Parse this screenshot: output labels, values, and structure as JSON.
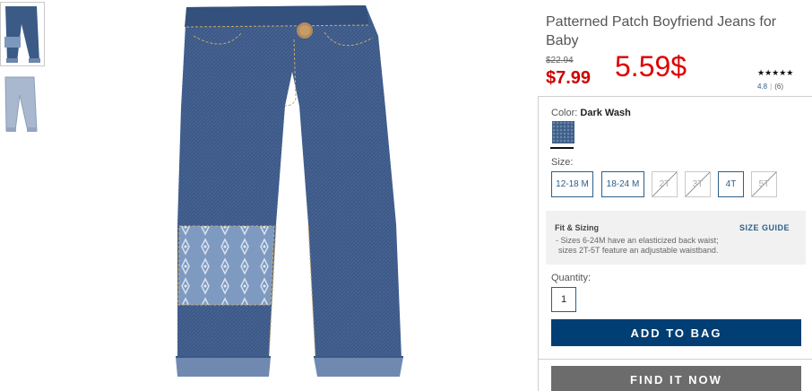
{
  "product": {
    "title": "Patterned Patch Boyfriend Jeans for Baby",
    "was_price": "$22.94",
    "price": "$7.99",
    "overlay_price": "5.59$",
    "stars": "★★★★★",
    "rating_value": "4.8",
    "rating_separator": "|",
    "rating_count": "(6)"
  },
  "thumbnails": [
    {
      "label": "",
      "selected": true
    },
    {
      "label": "",
      "selected": false
    }
  ],
  "options": {
    "color_label": "Color:",
    "color_value": "Dark Wash",
    "size_label": "Size:",
    "sizes": [
      {
        "label": "12-18 M",
        "available": true
      },
      {
        "label": "18-24 M",
        "available": true
      },
      {
        "label": "2T",
        "available": false
      },
      {
        "label": "3T",
        "available": false
      },
      {
        "label": "4T",
        "available": true
      },
      {
        "label": "5T",
        "available": false
      }
    ],
    "fit_title": "Fit & Sizing",
    "size_guide": "SIZE GUIDE",
    "fit_line1": "- Sizes 6-24M have an elasticized back waist;",
    "fit_line2": "sizes 2T-5T feature an adjustable waistband.",
    "quantity_label": "Quantity:",
    "quantity_value": "1",
    "add_to_bag": "ADD TO BAG",
    "find_it_now": "FIND IT NOW"
  },
  "colors": {
    "accent": "#003e73",
    "link": "#2b5f8a",
    "sale": "#d00000",
    "secondary_button": "#6c6c6c",
    "denim": "#3f5f86"
  }
}
